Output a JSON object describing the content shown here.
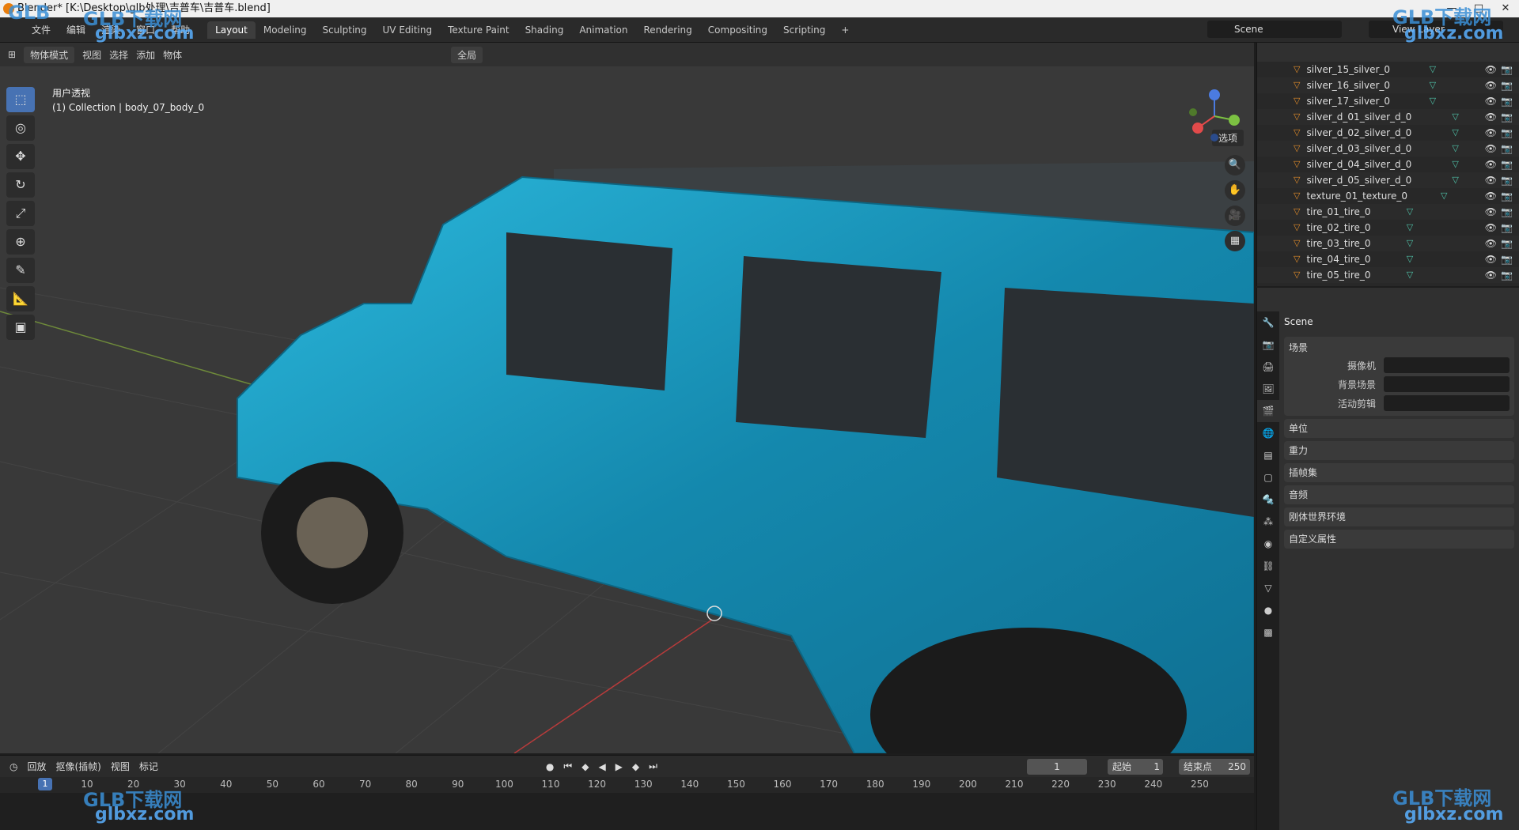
{
  "window": {
    "title": "Blender* [K:\\Desktop\\glb处理\\吉普车\\吉普车.blend]"
  },
  "menu": [
    "文件",
    "编辑",
    "渲染",
    "窗口",
    "帮助"
  ],
  "workspaces": [
    "Layout",
    "Modeling",
    "Sculpting",
    "UV Editing",
    "Texture Paint",
    "Shading",
    "Animation",
    "Rendering",
    "Compositing",
    "Scripting"
  ],
  "active_workspace": "Layout",
  "scene_selector": "Scene",
  "view_layer": "View Layer",
  "viewport_header": {
    "mode": "物体模式",
    "menus": [
      "视图",
      "选择",
      "添加",
      "物体"
    ],
    "transform_orientation": "全局",
    "options": "选项"
  },
  "viewport": {
    "view_name": "用户透视",
    "collection_info": "(1) Collection | body_07_body_0"
  },
  "outliner_items": [
    "silver_15_silver_0",
    "silver_16_silver_0",
    "silver_17_silver_0",
    "silver_d_01_silver_d_0",
    "silver_d_02_silver_d_0",
    "silver_d_03_silver_d_0",
    "silver_d_04_silver_d_0",
    "silver_d_05_silver_d_0",
    "texture_01_texture_0",
    "tire_01_tire_0",
    "tire_02_tire_0",
    "tire_03_tire_0",
    "tire_04_tire_0",
    "tire_05_tire_0"
  ],
  "properties": {
    "scene_name": "Scene",
    "panel_scene": "场景",
    "camera_label": "摄像机",
    "background_label": "背景场景",
    "clip_label": "活动剪辑",
    "sections": [
      "单位",
      "重力",
      "插帧集",
      "音频",
      "刚体世界环境",
      "自定义属性"
    ]
  },
  "timeline": {
    "menus": [
      "回放",
      "抠像(插帧)",
      "视图",
      "标记"
    ],
    "current_frame": "1",
    "start_label": "起始",
    "start_value": "1",
    "end_label": "结束点",
    "end_value": "250",
    "ruler": [
      "10",
      "20",
      "30",
      "40",
      "50",
      "60",
      "70",
      "80",
      "90",
      "100",
      "110",
      "120",
      "130",
      "140",
      "150",
      "160",
      "170",
      "180",
      "190",
      "200",
      "210",
      "220",
      "230",
      "240",
      "250"
    ],
    "marker": "1"
  },
  "watermarks": [
    "GLB下载网",
    "glbxz.com",
    "GLB",
    "GLB下载网",
    "glbxz.com"
  ],
  "colors": {
    "accent": "#4772b3",
    "car_body": "#1e9fc1",
    "selection": "#f39c12"
  }
}
